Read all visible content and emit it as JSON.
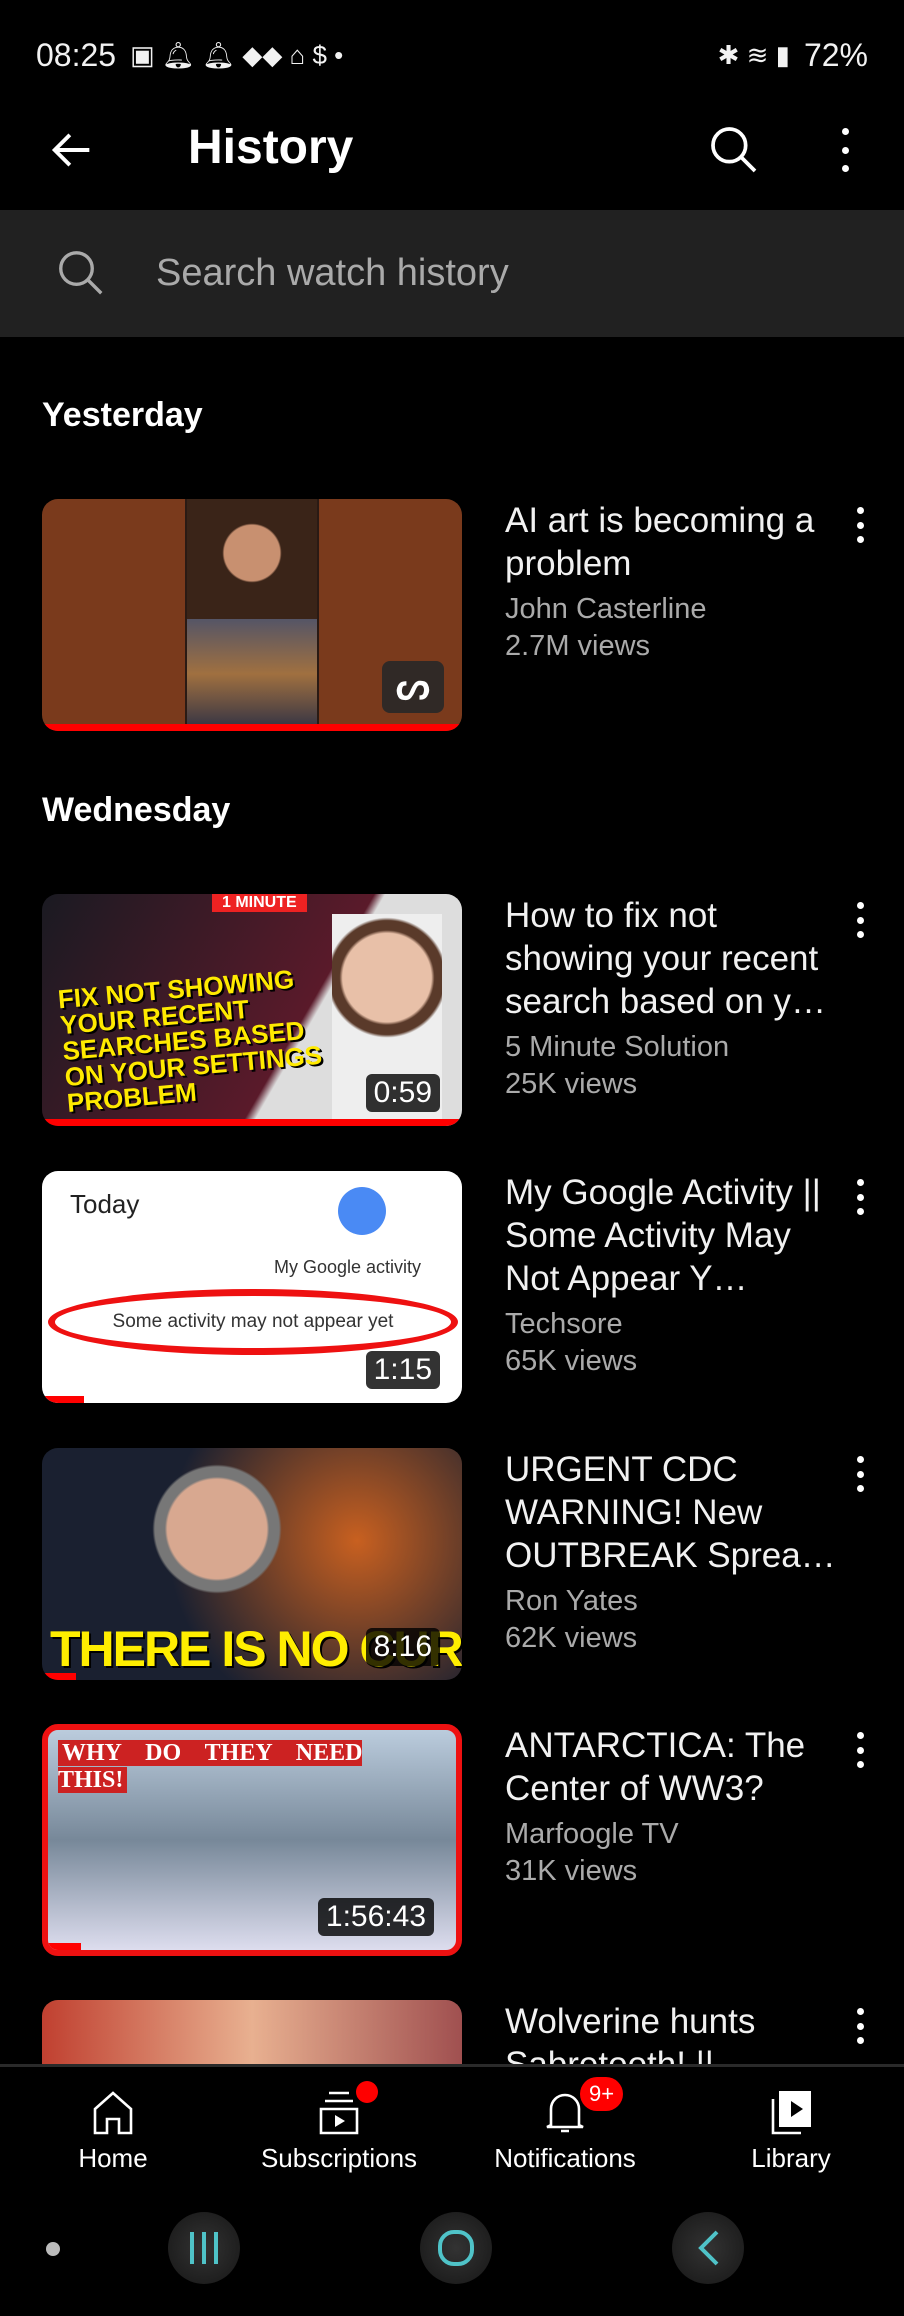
{
  "status_bar": {
    "time": "08:25",
    "battery": "72%"
  },
  "header": {
    "title": "History"
  },
  "search": {
    "placeholder": "Search watch history"
  },
  "sections": [
    {
      "label": "Yesterday"
    },
    {
      "label": "Wednesday"
    }
  ],
  "videos": [
    {
      "title": "AI art is becoming a problem",
      "channel": "John Casterline",
      "views": "2.7M views",
      "duration": "",
      "is_short": true,
      "progress": 1.0
    },
    {
      "title": "How to fix not showing your recent search based on y…",
      "channel": "5 Minute Solution",
      "views": "25K views",
      "duration": "0:59",
      "progress": 1.0,
      "thumb_text": "FIX NOT SHOWING YOUR RECENT SEARCHES BASED ON YOUR SETTINGS PROBLEM",
      "thumb_tag": "1 MINUTE"
    },
    {
      "title": "My Google Activity || Some Activity May Not Appear Y…",
      "channel": "Techsore",
      "views": "65K views",
      "duration": "1:15",
      "progress": 0.1,
      "thumb_text": "Some activity may not appear yet",
      "thumb_today": "Today",
      "thumb_sub": "My Google activity"
    },
    {
      "title": "URGENT CDC WARNING! New OUTBREAK Sprea…",
      "channel": "Ron Yates",
      "views": "62K views",
      "duration": "8:16",
      "progress": 0.08,
      "thumb_text": "THERE IS NO CURE"
    },
    {
      "title": "ANTARCTICA: The Center of WW3?",
      "channel": "Marfoogle TV",
      "views": "31K views",
      "duration": "1:56:43",
      "progress": 0.08,
      "thumb_text": "WHY DO THEY NEED THIS!"
    },
    {
      "title": "Wolverine hunts Sabretooth! ||",
      "channel": "",
      "views": "",
      "duration": ""
    }
  ],
  "bottom_nav": [
    {
      "label": "Home",
      "icon": "home-icon"
    },
    {
      "label": "Subscriptions",
      "icon": "subscriptions-icon"
    },
    {
      "label": "Notifications",
      "icon": "bell-icon",
      "badge": "9+"
    },
    {
      "label": "Library",
      "icon": "library-icon"
    }
  ],
  "colors": {
    "accent": "#ff0000",
    "background": "#000000",
    "search_bg": "#212121",
    "secondary_text": "#aaaaaa",
    "sysnav": "#4fc3c8"
  }
}
